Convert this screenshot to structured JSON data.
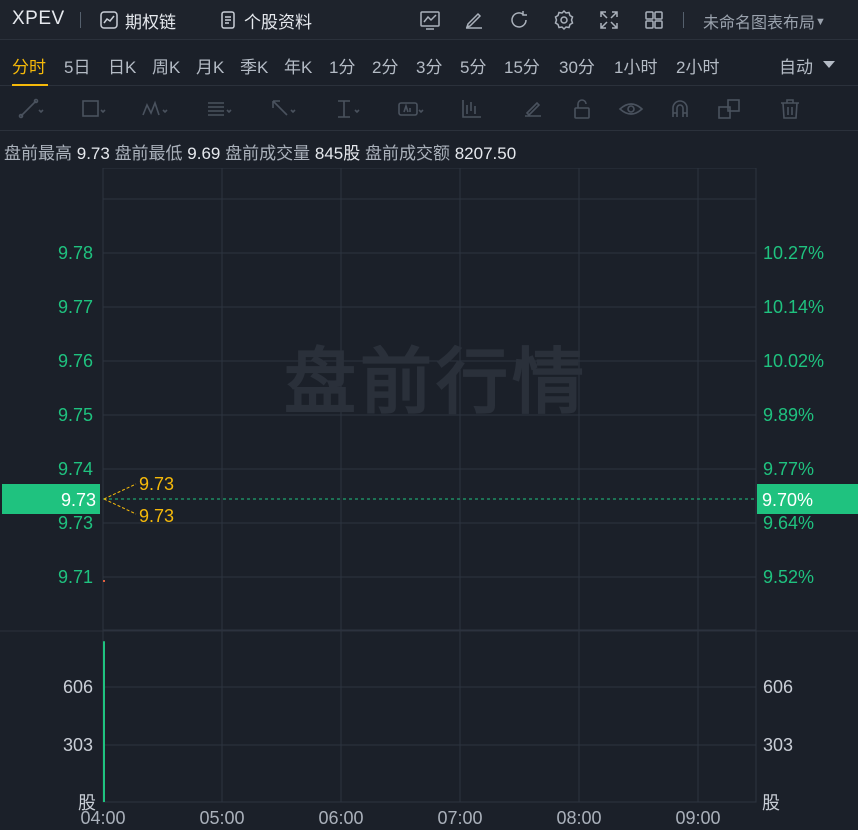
{
  "header": {
    "ticker": "XPEV",
    "option_chain_label": "期权链",
    "profile_label": "个股资料",
    "layout_label": "未命名图表布局"
  },
  "periods": {
    "items": [
      "分时",
      "5日",
      "日K",
      "周K",
      "月K",
      "季K",
      "年K",
      "1分",
      "2分",
      "3分",
      "5分",
      "15分",
      "30分",
      "1小时",
      "2小时"
    ],
    "active": "分时",
    "scale_mode": "自动"
  },
  "summary": {
    "high_label": "盘前最高",
    "high": "9.73",
    "low_label": "盘前最低",
    "low": "9.69",
    "volume_label": "盘前成交量",
    "volume": "845股",
    "amount_label": "盘前成交额",
    "amount": "8207.50"
  },
  "watermark": "盘前行情",
  "colors": {
    "up": "#1fc27f",
    "accent": "#f5b90a",
    "grid": "#2d3440",
    "bg": "#1b2029"
  },
  "chart_data": {
    "type": "line",
    "price_axis": {
      "ticks": [
        "9.78",
        "9.77",
        "9.76",
        "9.75",
        "9.74",
        "9.73",
        "9.71"
      ],
      "pct_ticks": [
        "10.27%",
        "10.14%",
        "10.02%",
        "9.89%",
        "9.77%",
        "9.64%",
        "9.52%"
      ],
      "current_price": "9.73",
      "current_pct": "9.70%",
      "last_high_label": "9.73",
      "last_low_label": "9.73"
    },
    "volume_axis": {
      "ticks": [
        "606",
        "303"
      ],
      "unit": "股"
    },
    "x_ticks": [
      "04:00",
      "05:00",
      "06:00",
      "07:00",
      "08:00",
      "09:00"
    ],
    "volume_bar": {
      "time": "04:00",
      "value": 845
    }
  }
}
